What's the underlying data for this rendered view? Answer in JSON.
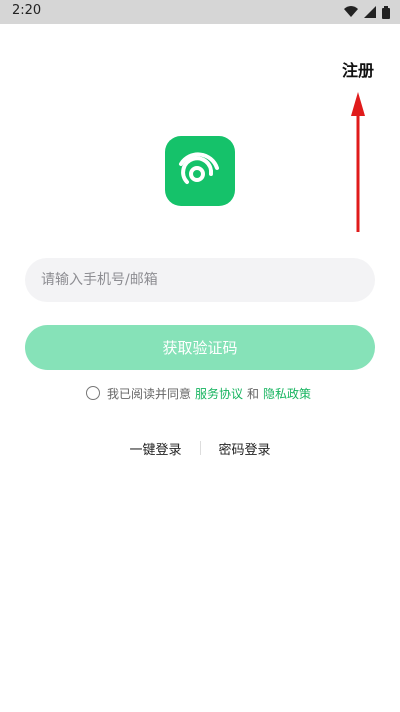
{
  "status": {
    "time": "2:20",
    "icons": [
      "wifi-icon",
      "cell-signal-icon",
      "battery-icon"
    ]
  },
  "header": {
    "register_label": "注册"
  },
  "form": {
    "phone_placeholder": "请输入手机号/邮箱",
    "get_code_label": "获取验证码"
  },
  "agreement": {
    "prefix": "我已阅读并同意",
    "service_link": "服务协议",
    "and_text": "和",
    "privacy_link": "隐私政策"
  },
  "login_options": {
    "one_click": "一键登录",
    "password": "密码登录"
  },
  "colors": {
    "accent": "#15c26a",
    "button_disabled": "#86e2b8",
    "link": "#16b45f",
    "arrow": "#e01b1b"
  }
}
